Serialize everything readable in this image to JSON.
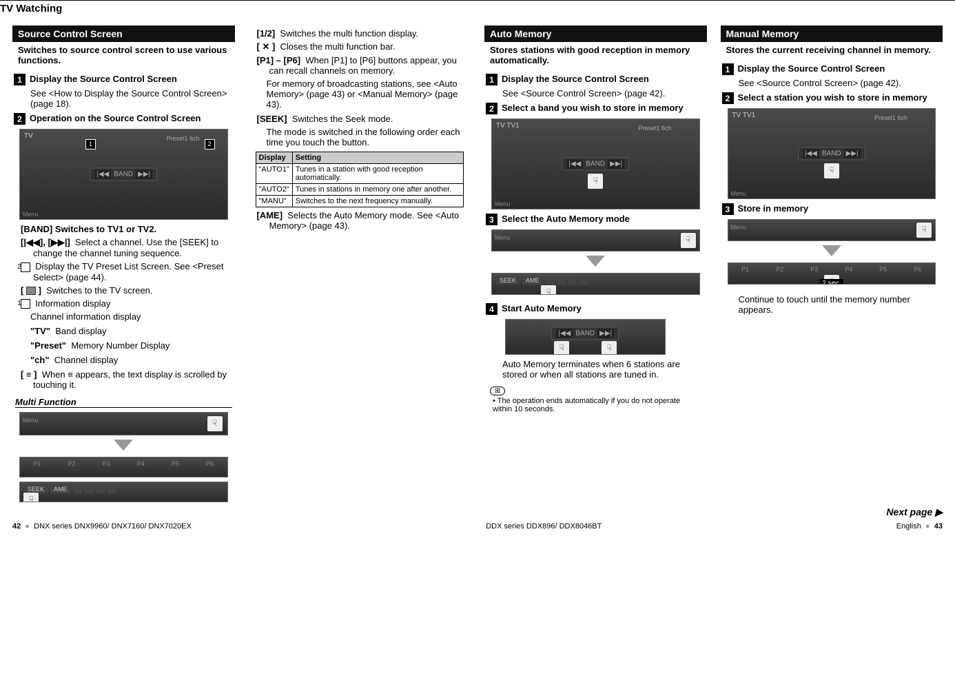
{
  "header": "TV Watching",
  "col1": {
    "blackbar": "Source Control Screen",
    "intro": "Switches to source control screen to use various functions.",
    "step1_title": "Display the Source Control Screen",
    "step1_body": "See <How to Display the Source Control Screen> (page 18).",
    "step2_title": "Operation on the Source Control Screen",
    "band_label": "BAND",
    "preset_label": "Preset1    6ch",
    "menu_label": "Menu",
    "item_band": "[BAND]   Switches to TV1 or TV2.",
    "item_prevnext_label": "[|◀◀], [▶▶|]",
    "item_prevnext_body": "Select a channel. Use the [SEEK] to change the channel tuning sequence.",
    "item_box2": "Display the TV Preset List Screen. See <Preset Select> (page 44).",
    "item_tvscreen": "Switches to the TV screen.",
    "item_box1": "Information display",
    "info_channel": "Channel information display",
    "info_tv_label": "\"TV\"",
    "info_tv": "Band display",
    "info_preset_label": "\"Preset\"",
    "info_preset": "Memory Number Display",
    "info_ch_label": "\"ch\"",
    "info_ch": "Channel display",
    "item_scroll_label": "[ ≡ ]",
    "item_scroll": "When  ≡  appears, the text display is scrolled by touching it.",
    "multifn_title": "Multi Function",
    "presets": [
      "P1",
      "P2",
      "P3",
      "P4",
      "P5",
      "P6"
    ],
    "seek_ame": [
      "SEEK",
      "AME"
    ]
  },
  "col2": {
    "i_12_label": "[1/2]",
    "i_12": "Switches the multi function display.",
    "i_close_label": "[ ✕ ]",
    "i_close": "Closes the multi function bar.",
    "i_p1p6_label": "[P1] – [P6]",
    "i_p1p6": "When [P1] to [P6] buttons appear,  you can recall channels on memory.",
    "i_p1p6_extra": "For memory of broadcasting stations, see <Auto Memory> (page 43) or <Manual Memory> (page 43).",
    "i_seek_label": "[SEEK]",
    "i_seek": "Switches the Seek mode.",
    "i_seek_extra": "The mode is switched in the following order each time you touch the button.",
    "table": {
      "headers": [
        "Display",
        "Setting"
      ],
      "rows": [
        [
          "\"AUTO1\"",
          "Tunes in a station with good reception automatically."
        ],
        [
          "\"AUTO2\"",
          "Tunes in stations in memory one after another."
        ],
        [
          "\"MANU\"",
          "Switches to the next frequency manually."
        ]
      ]
    },
    "i_ame_label": "[AME]",
    "i_ame": "Selects the Auto Memory mode. See <Auto Memory> (page 43)."
  },
  "col3": {
    "blackbar": "Auto Memory",
    "intro": "Stores stations with good reception in memory automatically.",
    "step1_title": "Display the Source Control Screen",
    "step1_body": "See <Source Control Screen> (page 42).",
    "step2_title": "Select a band you wish to store in memory",
    "band_label": "BAND",
    "preset_label": "Preset1    6ch",
    "tv1_label": "TV    TV1",
    "menu_label": "Menu",
    "step3_title": "Select the Auto Memory mode",
    "seek_ame": [
      "SEEK",
      "AME"
    ],
    "step4_title": "Start Auto Memory",
    "step4_body": "Auto Memory terminates when 6 stations are stored or when all stations are tuned in.",
    "note": "The operation ends automatically if you do not operate within 10 seconds."
  },
  "col4": {
    "blackbar": "Manual Memory",
    "intro": "Stores the current receiving channel in memory.",
    "step1_title": "Display the Source Control Screen",
    "step1_body": "See <Source Control Screen> (page 42).",
    "step2_title": "Select a station you wish to store in memory",
    "band_label": "BAND",
    "preset_label": "Preset1    6ch",
    "tv1_label": "TV    TV1",
    "menu_label": "Menu",
    "step3_title": "Store in memory",
    "presets": [
      "P1",
      "P2",
      "P3",
      "P4",
      "P5",
      "P6"
    ],
    "sec_tag": "2 sec.",
    "step3_body": "Continue to touch until the memory number appears."
  },
  "nextpage": "Next page ▶",
  "footer": {
    "left_page": "42",
    "left_series": "DNX series   DNX9960/ DNX7160/ DNX7020EX",
    "right_series": "DDX series   DDX896/ DDX8046BT",
    "right_lang": "English",
    "right_page": "43"
  }
}
